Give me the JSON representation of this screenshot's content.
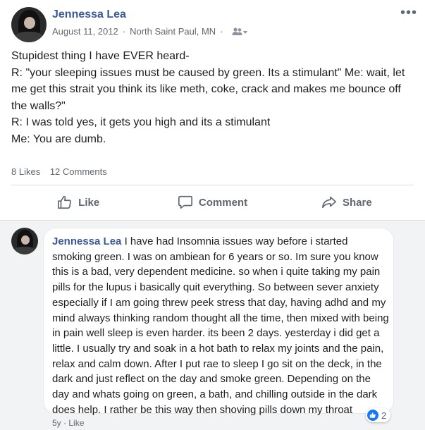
{
  "post": {
    "author": "Jennessa Lea",
    "date": "August 11, 2012",
    "separator": "·",
    "location": "North Saint Paul, MN",
    "more_icon": "ellipsis-icon",
    "privacy_icon": "friends-icon",
    "lines": [
      "Stupidest thing I have EVER heard-",
      "R: \"your sleeping issues must be caused by green. Its a stimulant\" Me: wait, let me get this strait you think its like meth, coke, crack and makes me bounce off the walls?\"",
      "R: I was told yes, it gets you high and its a stimulant",
      "Me: You are dumb."
    ],
    "likes": "8 Likes",
    "comments": "12 Comments"
  },
  "actions": {
    "like": "Like",
    "comment": "Comment",
    "share": "Share"
  },
  "comment": {
    "author": "Jennessa Lea",
    "text": "I have had Insomnia issues way before i started smoking green. I was on ambiean for 6 years or so. Im sure you know this is a bad, very dependent medicine. so when i quite taking my pain pills for the lupus i basically quit everything. So between sever anxiety especially if I am going threw peek stress that day, having adhd and my mind always thinking random thought all the time, then mixed with being in pain well sleep is even harder. its been 2 days. yesterday i did get a little. I usually try and soak in a hot bath to relax my joints and the pain, relax and calm down. After I put rae to sleep I go sit on the deck, in the dark and just reflect on the day and smoke green. Depending on the day and whats going on green, a bath, and chilling outside in the dark does help. I rather be this way then shoving pills down my throat",
    "reaction_count": "2",
    "age": "5y",
    "dot": "·",
    "like_link": "Like"
  },
  "colors": {
    "author": "#385898",
    "text": "#1c1e21",
    "muted": "#606770",
    "like_blue": "#1877f2",
    "comment_bg": "#f2f3f5"
  }
}
